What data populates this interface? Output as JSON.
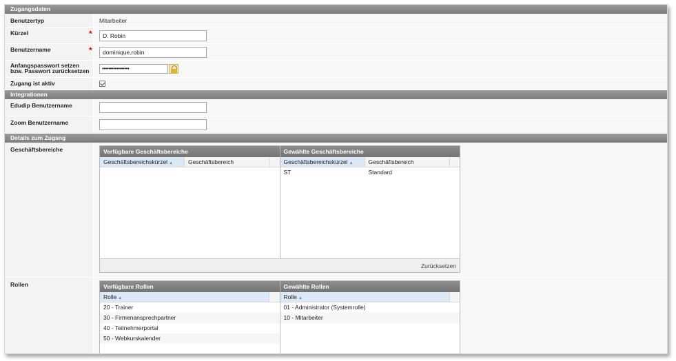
{
  "zugang": {
    "section_title": "Zugangsdaten",
    "benutzertyp_label": "Benutzertyp",
    "benutzertyp_value": "Mitarbeiter",
    "kuerzel_label": "Kürzel",
    "kuerzel_value": "D. Robin",
    "benutzername_label": "Benutzername",
    "benutzername_value": "dominique.robin",
    "passwort_label_line1": "Anfangspasswort setzen",
    "passwort_label_line2": "bzw. Passwort zurücksetzen",
    "passwort_value": "•••••••••••••••••",
    "aktiv_label": "Zugang ist aktiv",
    "required_marker": "*"
  },
  "integrationen": {
    "section_title": "Integrationen",
    "edudip_label": "Edudip Benutzername",
    "edudip_value": "",
    "zoom_label": "Zoom Benutzername",
    "zoom_value": ""
  },
  "details": {
    "section_title": "Details zum Zugang",
    "geschaeftsbereiche_label": "Geschäftsbereiche",
    "gb_available_title": "Verfügbare Geschäftsbereiche",
    "gb_selected_title": "Gewählte Geschäftsbereiche",
    "gb_col_kuerzel": "Geschäftsbereichskürzel",
    "gb_col_bereich": "Geschäftsbereich",
    "gb_selected_rows": [
      {
        "kuerzel": "ST",
        "bereich": "Standard"
      }
    ],
    "reset_label": "Zurücksetzen",
    "rollen_label": "Rollen",
    "rollen_available_title": "Verfügbare Rollen",
    "rollen_selected_title": "Gewählte Rollen",
    "rollen_col": "Rolle",
    "rollen_available_rows": [
      "20 - Trainer",
      "30 - Firmenansprechpartner",
      "40 - Teilnehmerportal",
      "50 - Webkurskalender"
    ],
    "rollen_selected_rows": [
      "01 - Administrator (Systemrolle)",
      "10 - Mitarbeiter"
    ]
  }
}
